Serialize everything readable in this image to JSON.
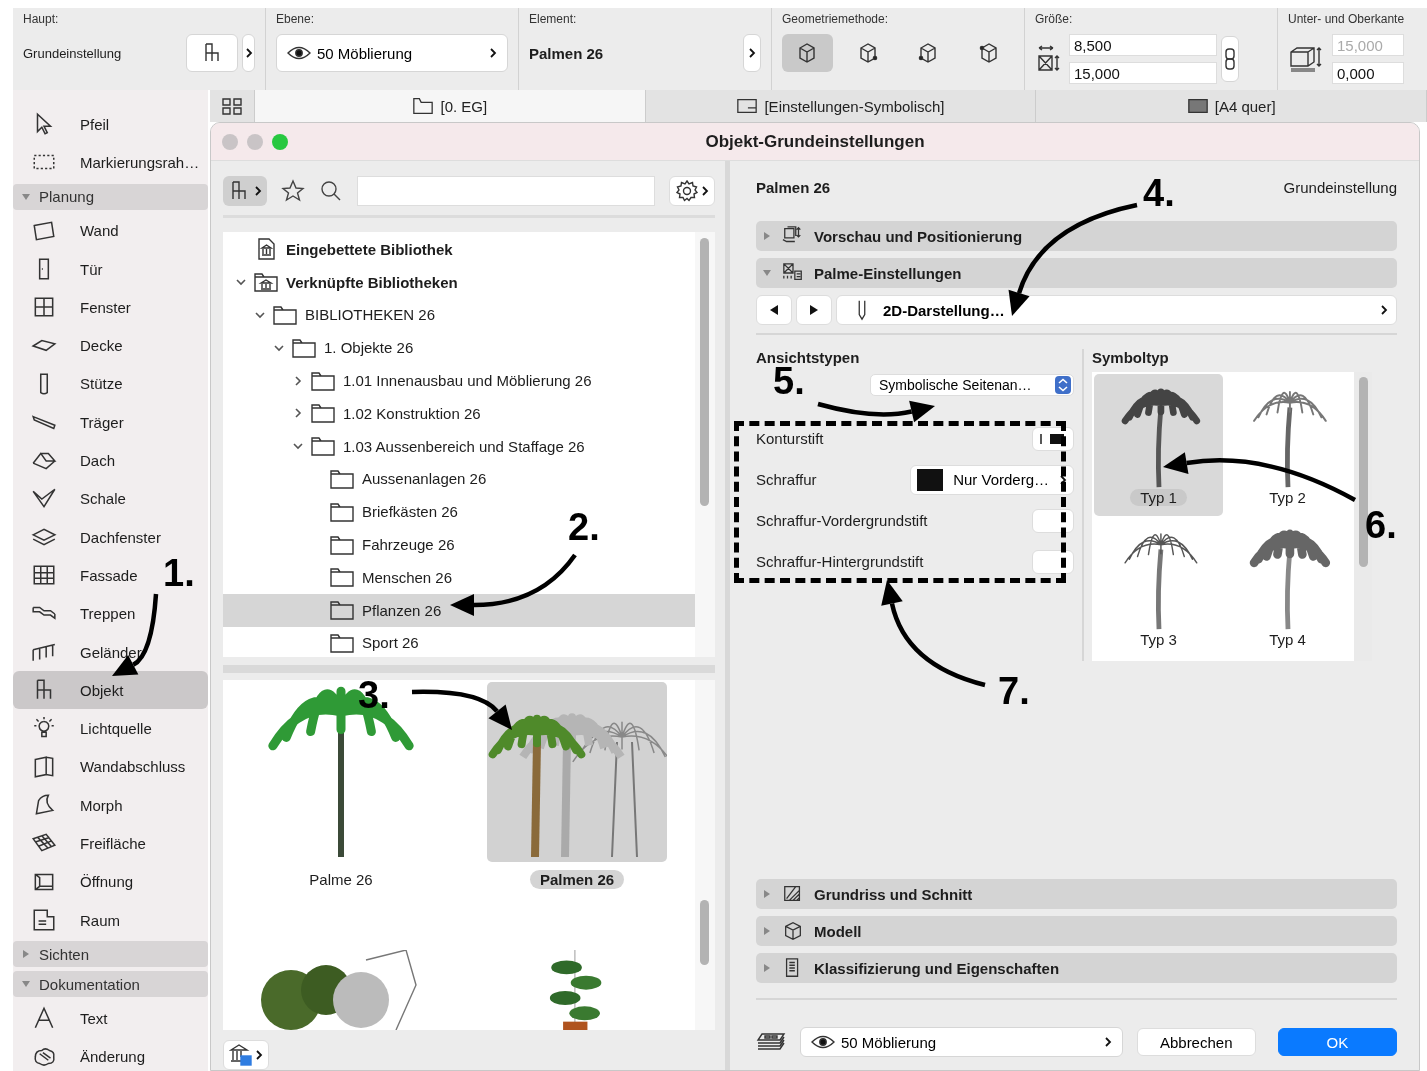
{
  "toolbar": {
    "main": {
      "label": "Haupt:",
      "value": "Grundeinstellung"
    },
    "layer": {
      "label": "Ebene:",
      "value": "50 Möblierung"
    },
    "element": {
      "label": "Element:",
      "value": "Palmen 26"
    },
    "geometry": {
      "label": "Geometriemethode:",
      "options": [
        {
          "selected": true
        },
        {
          "selected": false
        },
        {
          "selected": false
        },
        {
          "selected": false
        }
      ]
    },
    "size": {
      "label": "Größe:",
      "values": [
        "8,500",
        "15,000"
      ]
    },
    "elevation": {
      "label": "Unter- und Oberkante",
      "fields": [
        {
          "value": "15,000",
          "disabled": true
        },
        {
          "value": "0,000",
          "disabled": false
        }
      ]
    }
  },
  "view_tabs": [
    {
      "label": "[0. EG]",
      "kind": "story",
      "selected": true
    },
    {
      "label": "[Einstellungen-Symbolisch]",
      "kind": "section",
      "selected": false
    },
    {
      "label": "[A4 quer]",
      "kind": "layout",
      "selected": false
    }
  ],
  "sidebar": {
    "items": [
      {
        "kind": "tool",
        "label": "Pfeil",
        "selected": false
      },
      {
        "kind": "tool",
        "label": "Markierungsrah…",
        "selected": false
      },
      {
        "kind": "group",
        "label": "Planung",
        "expanded": true
      },
      {
        "kind": "tool",
        "label": "Wand",
        "selected": false
      },
      {
        "kind": "tool",
        "label": "Tür",
        "selected": false
      },
      {
        "kind": "tool",
        "label": "Fenster",
        "selected": false
      },
      {
        "kind": "tool",
        "label": "Decke",
        "selected": false
      },
      {
        "kind": "tool",
        "label": "Stütze",
        "selected": false
      },
      {
        "kind": "tool",
        "label": "Träger",
        "selected": false
      },
      {
        "kind": "tool",
        "label": "Dach",
        "selected": false
      },
      {
        "kind": "tool",
        "label": "Schale",
        "selected": false
      },
      {
        "kind": "tool",
        "label": "Dachfenster",
        "selected": false
      },
      {
        "kind": "tool",
        "label": "Fassade",
        "selected": false
      },
      {
        "kind": "tool",
        "label": "Treppen",
        "selected": false
      },
      {
        "kind": "tool",
        "label": "Geländer",
        "selected": false
      },
      {
        "kind": "tool",
        "label": "Objekt",
        "selected": true
      },
      {
        "kind": "tool",
        "label": "Lichtquelle",
        "selected": false
      },
      {
        "kind": "tool",
        "label": "Wandabschluss",
        "selected": false
      },
      {
        "kind": "tool",
        "label": "Morph",
        "selected": false
      },
      {
        "kind": "tool",
        "label": "Freifläche",
        "selected": false
      },
      {
        "kind": "tool",
        "label": "Öffnung",
        "selected": false
      },
      {
        "kind": "tool",
        "label": "Raum",
        "selected": false
      },
      {
        "kind": "group",
        "label": "Sichten",
        "expanded": false
      },
      {
        "kind": "group",
        "label": "Dokumentation",
        "expanded": true
      },
      {
        "kind": "tool",
        "label": "Text",
        "selected": false
      },
      {
        "kind": "tool",
        "label": "Änderung",
        "selected": false
      }
    ]
  },
  "dialog": {
    "title": "Objekt-Grundeinstellungen",
    "window_controls": [
      {
        "kind": "close",
        "enabled": false
      },
      {
        "kind": "minimize",
        "enabled": false
      },
      {
        "kind": "zoom",
        "enabled": true
      }
    ]
  },
  "library": {
    "tree": [
      {
        "label": "Eingebettete Bibliothek",
        "kind": "embedded",
        "selected": false
      },
      {
        "label": "Verknüpfte Bibliotheken",
        "kind": "linked",
        "expanded": true,
        "selected": false,
        "children": [
          {
            "label": "BIBLIOTHEKEN 26",
            "kind": "folder",
            "expanded": true,
            "selected": false,
            "children": [
              {
                "label": "1. Objekte 26",
                "kind": "folder",
                "expanded": true,
                "selected": false,
                "children": [
                  {
                    "label": "1.01 Innenausbau und Möblierung 26",
                    "kind": "folder",
                    "expanded": false,
                    "selected": false
                  },
                  {
                    "label": "1.02 Konstruktion 26",
                    "kind": "folder",
                    "expanded": false,
                    "selected": false
                  },
                  {
                    "label": "1.03 Aussenbereich und Staffage 26",
                    "kind": "folder",
                    "expanded": true,
                    "selected": false,
                    "children": [
                      {
                        "label": "Aussenanlagen 26",
                        "kind": "folder",
                        "selected": false
                      },
                      {
                        "label": "Briefkästen 26",
                        "kind": "folder",
                        "selected": false
                      },
                      {
                        "label": "Fahrzeuge 26",
                        "kind": "folder",
                        "selected": false
                      },
                      {
                        "label": "Menschen 26",
                        "kind": "folder",
                        "selected": false
                      },
                      {
                        "label": "Pflanzen 26",
                        "kind": "folder",
                        "selected": true
                      },
                      {
                        "label": "Sport 26",
                        "kind": "folder",
                        "selected": false
                      }
                    ]
                  }
                ]
              }
            ]
          }
        ]
      }
    ],
    "gallery": [
      {
        "label": "Palme 26",
        "selected": false
      },
      {
        "label": "Palmen 26",
        "selected": true
      }
    ]
  },
  "settings": {
    "name": "Palmen 26",
    "preset": "Grundeinstellung",
    "sections": [
      {
        "label": "Vorschau und Positionierung",
        "kind": "preview",
        "expanded": false
      },
      {
        "label": "Palme-Einstellungen",
        "kind": "parameters",
        "expanded": true
      },
      {
        "label": "Grundriss und Schnitt",
        "kind": "plan",
        "expanded": false
      },
      {
        "label": "Modell",
        "kind": "model",
        "expanded": false
      },
      {
        "label": "Klassifizierung und Eigenschaften",
        "kind": "classification",
        "expanded": false
      }
    ],
    "page": "2D-Darstellung…",
    "view_types": {
      "heading": "Ansichtstypen",
      "dropdown": "Symbolische Seitenan…",
      "rows": [
        {
          "label": "Konturstift",
          "kind": "pen"
        },
        {
          "label": "Schraffur",
          "kind": "fill",
          "value": "Nur Vorderg…"
        },
        {
          "label": "Schraffur-Vordergrundstift",
          "kind": "blank"
        },
        {
          "label": "Schraffur-Hintergrundstift",
          "kind": "blank"
        }
      ]
    },
    "symbol_type": {
      "heading": "Symboltyp",
      "items": [
        {
          "label": "Typ 1",
          "selected": true
        },
        {
          "label": "Typ 2",
          "selected": false
        },
        {
          "label": "Typ 3",
          "selected": false
        },
        {
          "label": "Typ 4",
          "selected": false
        }
      ]
    }
  },
  "footer": {
    "layer": "50 Möblierung",
    "buttons": [
      {
        "label": "Abbrechen",
        "kind": "cancel"
      },
      {
        "label": "OK",
        "kind": "primary"
      }
    ]
  },
  "annotations": [
    {
      "label": "1."
    },
    {
      "label": "2."
    },
    {
      "label": "3."
    },
    {
      "label": "4."
    },
    {
      "label": "5."
    },
    {
      "label": "6."
    },
    {
      "label": "7."
    }
  ]
}
